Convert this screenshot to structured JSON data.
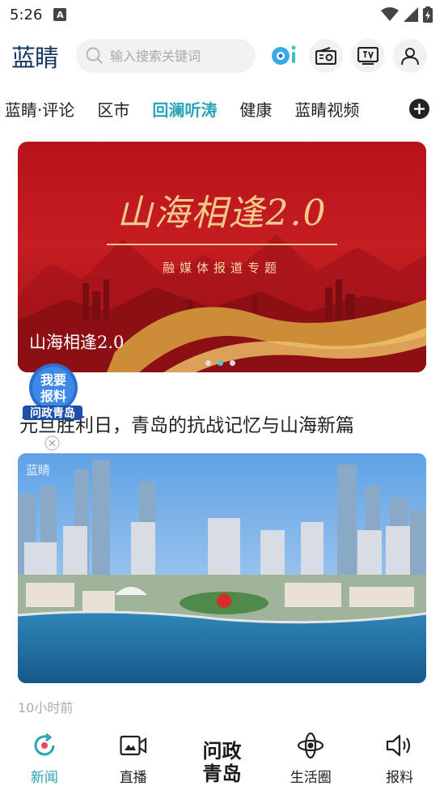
{
  "status_bar": {
    "time": "5:26",
    "a_badge": "A"
  },
  "header": {
    "logo": "蓝睛",
    "search_placeholder": "输入搜索关键词",
    "icons": [
      "ai-icon",
      "radio-icon",
      "tv-icon",
      "user-icon"
    ]
  },
  "tabs": [
    {
      "label": "蓝睛·评论"
    },
    {
      "label": "区市"
    },
    {
      "label": "回澜听涛"
    },
    {
      "label": "健康"
    },
    {
      "label": "蓝睛视频"
    }
  ],
  "active_tab": "回澜听涛",
  "banner": {
    "art_title": "山海相逢2.0",
    "art_subtitle": "融媒体报道专题",
    "caption": "山海相逢2.0",
    "slides": 3,
    "active_slide": 2
  },
  "float_badge": {
    "line1": "我要",
    "line2": "报料",
    "bottom": "问政青岛"
  },
  "news": {
    "title": "元旦胜利日，青岛的抗战记忆与山海新篇",
    "watermark": "蓝睛",
    "time": "10小时前"
  },
  "bottom_nav": {
    "items": [
      {
        "label": "新闻",
        "active": true
      },
      {
        "label": "直播",
        "active": false
      },
      {
        "label": "问政青岛",
        "active": false
      },
      {
        "label": "生活圈",
        "active": false
      },
      {
        "label": "报料",
        "active": false
      }
    ],
    "center_line1": "问政",
    "center_line2": "青岛"
  },
  "colors": {
    "accent": "#29a3b8",
    "banner_red": "#c51d22",
    "logo_blue": "#1a3a66"
  }
}
